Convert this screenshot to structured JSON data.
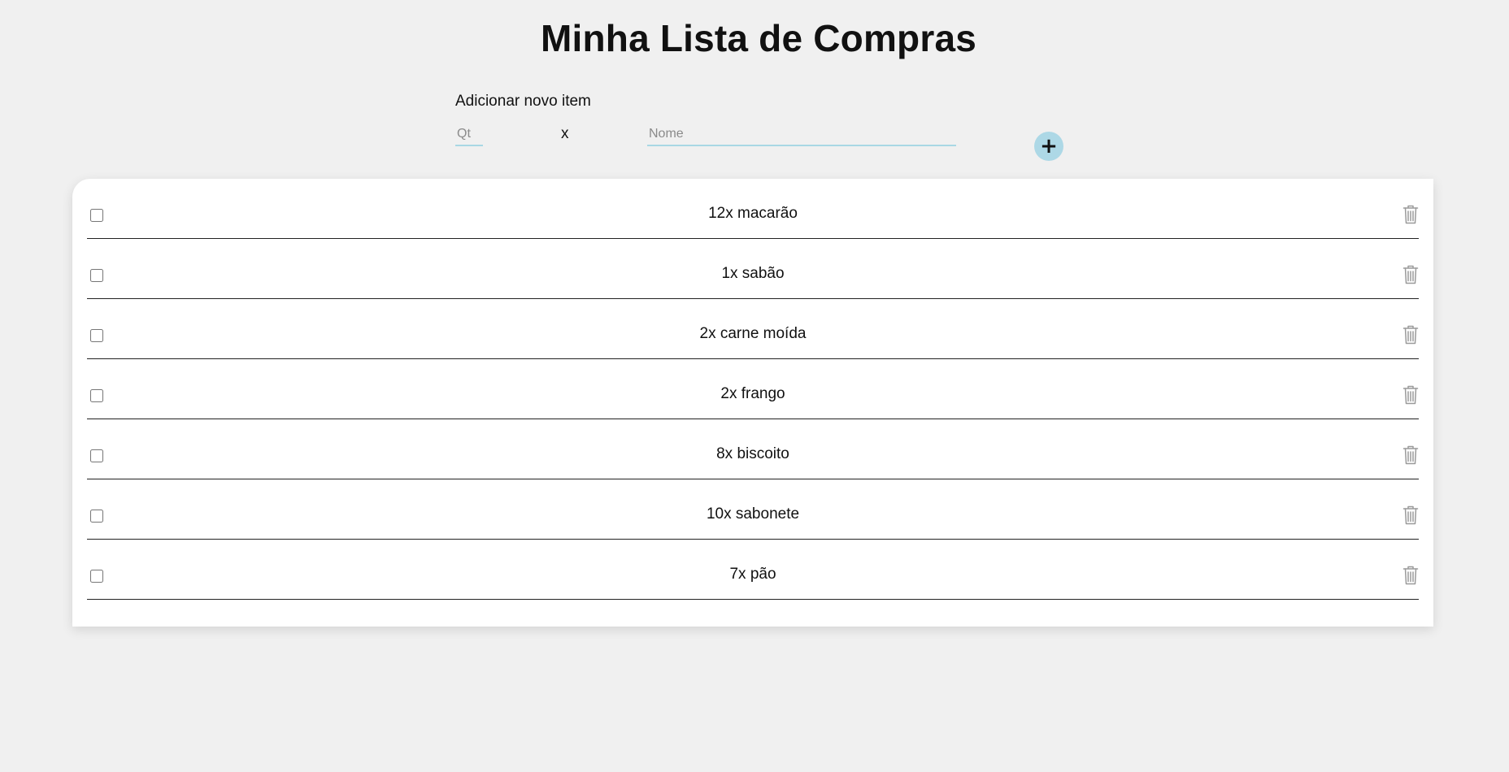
{
  "page": {
    "title": "Minha Lista de Compras"
  },
  "add_form": {
    "label": "Adicionar novo item",
    "qty_placeholder": "Qt",
    "times": "x",
    "name_placeholder": "Nome",
    "add_button": "+"
  },
  "items": [
    {
      "text": "12x macarão",
      "checked": false
    },
    {
      "text": "1x sabão",
      "checked": false
    },
    {
      "text": "2x carne moída",
      "checked": false
    },
    {
      "text": "2x frango",
      "checked": false
    },
    {
      "text": "8x biscoito",
      "checked": false
    },
    {
      "text": "10x sabonete",
      "checked": false
    },
    {
      "text": "7x pão",
      "checked": false
    }
  ],
  "icons": {
    "delete": "trash-icon",
    "add": "plus-icon"
  },
  "colors": {
    "background": "#f0f0f0",
    "panel": "#ffffff",
    "accent": "#add8e6",
    "input_underline": "#a9d8e4",
    "trash": "#9a9a9a"
  }
}
